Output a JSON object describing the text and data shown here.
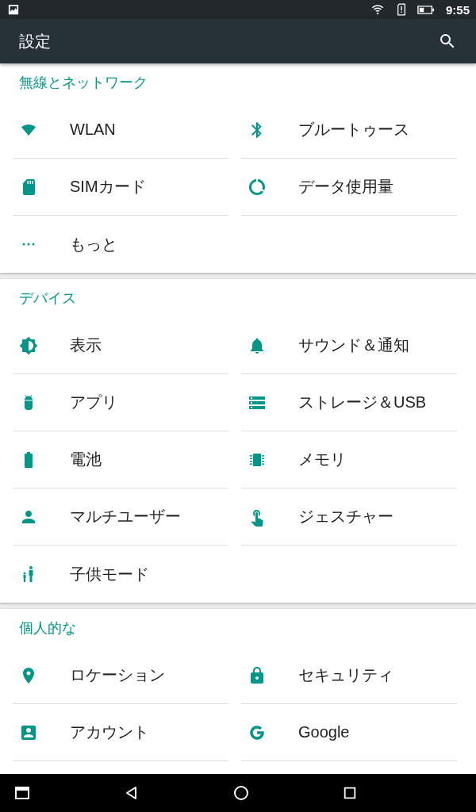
{
  "status_bar": {
    "time": "9:55"
  },
  "app_bar": {
    "title": "設定"
  },
  "sections": [
    {
      "title": "無線とネットワーク",
      "continues": false,
      "items": [
        {
          "kind": "wifi",
          "label": "WLAN"
        },
        {
          "kind": "bluetooth",
          "label": "ブルートゥース"
        },
        {
          "kind": "sim",
          "label": "SIMカード"
        },
        {
          "kind": "data",
          "label": "データ使用量"
        },
        {
          "kind": "more",
          "label": "もっと"
        }
      ]
    },
    {
      "title": "デバイス",
      "continues": false,
      "items": [
        {
          "kind": "display",
          "label": "表示"
        },
        {
          "kind": "bell",
          "label": "サウンド＆通知"
        },
        {
          "kind": "android",
          "label": "アプリ"
        },
        {
          "kind": "storage",
          "label": "ストレージ＆USB"
        },
        {
          "kind": "battery",
          "label": "電池"
        },
        {
          "kind": "memory",
          "label": "メモリ"
        },
        {
          "kind": "person",
          "label": "マルチユーザー"
        },
        {
          "kind": "gesture",
          "label": "ジェスチャー"
        },
        {
          "kind": "family",
          "label": "子供モード"
        }
      ]
    },
    {
      "title": "個人的な",
      "continues": true,
      "items": [
        {
          "kind": "location",
          "label": "ロケーション"
        },
        {
          "kind": "lock",
          "label": "セキュリティ"
        },
        {
          "kind": "account",
          "label": "アカウント"
        },
        {
          "kind": "g",
          "label": "Google"
        }
      ]
    }
  ]
}
